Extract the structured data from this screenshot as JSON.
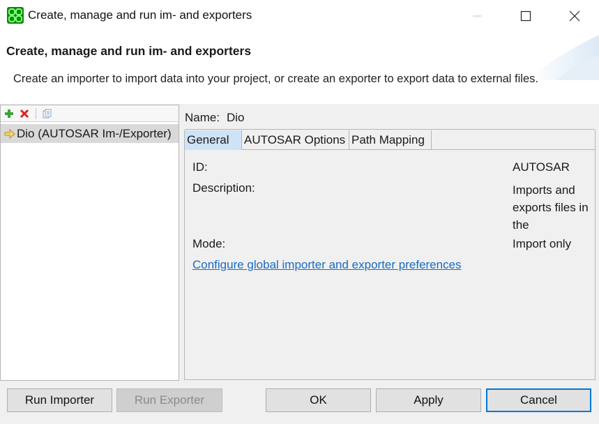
{
  "window": {
    "title": "Create, manage and run im- and exporters",
    "icon": "app-logo-icon",
    "controls": [
      "minimize-icon",
      "maximize-icon",
      "close-icon"
    ]
  },
  "header": {
    "heading": "Create, manage and run im- and exporters",
    "description": "Create an importer to import data into your project, or create an exporter to export data to external files."
  },
  "left_panel": {
    "toolbar": [
      "add-icon",
      "delete-icon",
      "copy-icon"
    ],
    "items": [
      {
        "label": "Dio (AUTOSAR Im-/Exporter)",
        "icon": "arrow-right-icon",
        "selected": true
      }
    ]
  },
  "details": {
    "name_label": "Name:",
    "name_value": "Dio",
    "tabs": [
      {
        "label": "General",
        "active": true
      },
      {
        "label": "AUTOSAR Options",
        "active": false
      },
      {
        "label": "Path Mapping",
        "active": false
      }
    ],
    "general": {
      "id_label": "ID:",
      "id_value": "AUTOSAR",
      "description_label": "Description:",
      "description_value": "Imports and exports files in the",
      "mode_label": "Mode:",
      "mode_value": "Import only",
      "config_link": "Configure global importer and exporter preferences"
    }
  },
  "buttons": {
    "run_importer": "Run Importer",
    "run_exporter": "Run Exporter",
    "ok": "OK",
    "apply": "Apply",
    "cancel": "Cancel"
  },
  "colors": {
    "accent": "#0078d7",
    "link": "#1a6bbf",
    "selected_tab": "#cfe3f7",
    "selected_item": "#d9d9d9"
  }
}
